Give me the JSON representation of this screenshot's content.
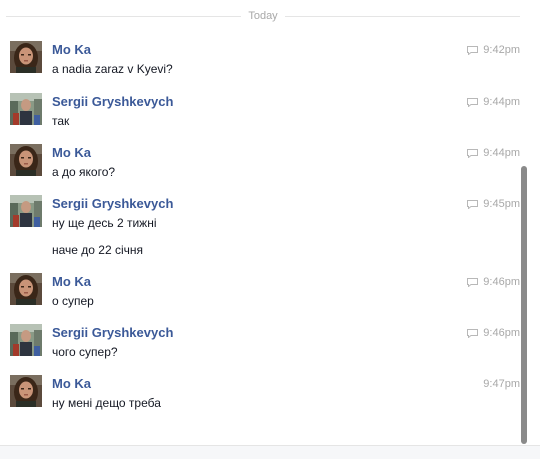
{
  "divider": {
    "label": "Today"
  },
  "messages": [
    {
      "sender": "Mo Ka",
      "time": "9:42pm",
      "lines": [
        "a nadia zaraz v Kyevi?"
      ],
      "avatar": "mo-ka-avatar",
      "sent_icon": true
    },
    {
      "sender": "Sergii Gryshkevych",
      "time": "9:44pm",
      "lines": [
        "так"
      ],
      "avatar": "sergii-avatar",
      "sent_icon": true
    },
    {
      "sender": "Mo Ka",
      "time": "9:44pm",
      "lines": [
        "а до якого?"
      ],
      "avatar": "mo-ka-avatar",
      "sent_icon": true
    },
    {
      "sender": "Sergii Gryshkevych",
      "time": "9:45pm",
      "lines": [
        "ну ще десь 2 тижні",
        "наче до 22 січня"
      ],
      "avatar": "sergii-avatar",
      "sent_icon": true
    },
    {
      "sender": "Mo Ka",
      "time": "9:46pm",
      "lines": [
        "о супер"
      ],
      "avatar": "mo-ka-avatar",
      "sent_icon": true
    },
    {
      "sender": "Sergii Gryshkevych",
      "time": "9:46pm",
      "lines": [
        "чого супер?"
      ],
      "avatar": "sergii-avatar",
      "sent_icon": true
    },
    {
      "sender": "Mo Ka",
      "time": "9:47pm",
      "lines": [
        "ну мені дещо треба"
      ],
      "avatar": "mo-ka-avatar",
      "sent_icon": false
    }
  ],
  "colors": {
    "sender_name": "#3b5998",
    "timestamp": "#a8a8a8",
    "message_text": "#141823",
    "scrollbar": "#8a8a8a"
  }
}
